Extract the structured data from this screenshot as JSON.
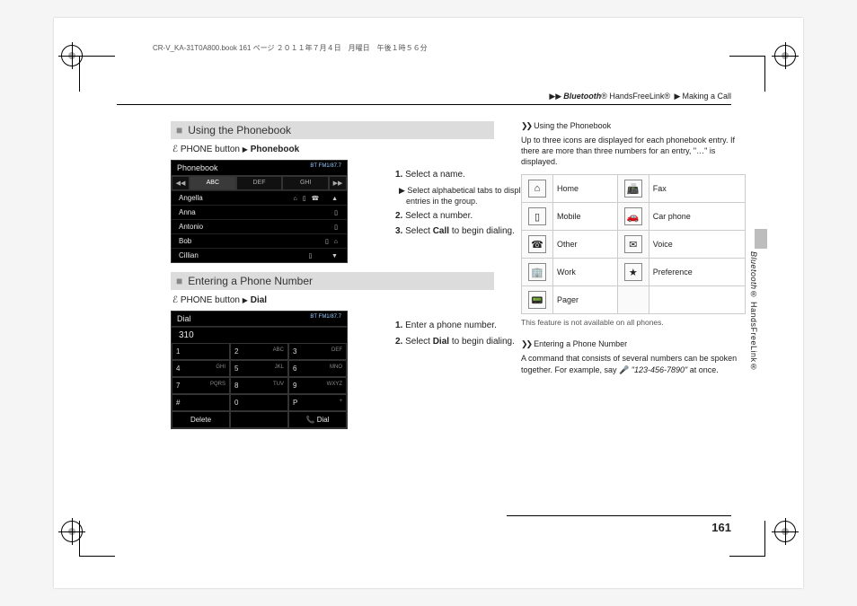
{
  "source_line": "CR-V_KA-31T0A800.book  161 ページ  ２０１１年７月４日　月曜日　午後１時５６分",
  "breadcrumb": {
    "a": "Bluetooth",
    "a2": "® HandsFreeLink®",
    "b": "Making a Call"
  },
  "section1": {
    "heading": "Using the Phonebook",
    "nav_a": "PHONE button",
    "nav_b": "Phonebook",
    "gui_title": "Phonebook",
    "gui_status": "BT  FM1/87.7",
    "tabs": {
      "t1": "ABC",
      "t2": "DEF",
      "t3": "GHI"
    },
    "rows": [
      "Angella",
      "Anna",
      "Antonio",
      "Bob",
      "Cillian"
    ],
    "steps": {
      "s1": "Select a name.",
      "s1sub": "Select alphabetical tabs to display the entries in the group.",
      "s2": "Select a number.",
      "s3a": "Select ",
      "s3b": "Call",
      "s3c": " to begin dialing."
    }
  },
  "section2": {
    "heading": "Entering a Phone Number",
    "nav_a": "PHONE button",
    "nav_b": "Dial",
    "gui_title": "Dial",
    "gui_status": "BT  FM1/87.7",
    "entered": "310",
    "keys": [
      {
        "n": "1",
        "s": ""
      },
      {
        "n": "2",
        "s": "ABC"
      },
      {
        "n": "3",
        "s": "DEF"
      },
      {
        "n": "4",
        "s": "GHI"
      },
      {
        "n": "5",
        "s": "JKL"
      },
      {
        "n": "6",
        "s": "MNO"
      },
      {
        "n": "7",
        "s": "PQRS"
      },
      {
        "n": "8",
        "s": "TUV"
      },
      {
        "n": "9",
        "s": "WXYZ"
      },
      {
        "n": "#",
        "s": ""
      },
      {
        "n": "0",
        "s": ""
      },
      {
        "n": "P",
        "s": "+"
      }
    ],
    "footer": {
      "del": "Delete",
      "dial": "Dial"
    },
    "steps": {
      "s1": "Enter a phone number.",
      "s2a": "Select ",
      "s2b": "Dial",
      "s2c": " to begin dialing."
    }
  },
  "side": {
    "h1": "Using the Phonebook",
    "p1": "Up to three icons are displayed for each phonebook entry. If there are more than three numbers for an entry, \"…\" is displayed.",
    "icons": [
      {
        "g": "⌂",
        "t": "Home"
      },
      {
        "g": "📠",
        "t": "Fax"
      },
      {
        "g": "▯",
        "t": "Mobile"
      },
      {
        "g": "🚗",
        "t": "Car phone"
      },
      {
        "g": "☎",
        "t": "Other"
      },
      {
        "g": "✉",
        "t": "Voice"
      },
      {
        "g": "🏢",
        "t": "Work"
      },
      {
        "g": "★",
        "t": "Preference"
      },
      {
        "g": "📟",
        "t": "Pager"
      }
    ],
    "note": "This feature is not available on all phones.",
    "h2": "Entering a Phone Number",
    "p2a": "A command that consists of several numbers can be spoken together. For example, say 🎤 ",
    "p2b": "\"123-456-7890\"",
    "p2c": " at once."
  },
  "spine": {
    "a": "Bluetooth",
    "b": "® HandsFreeLink®"
  },
  "page_number": "161"
}
